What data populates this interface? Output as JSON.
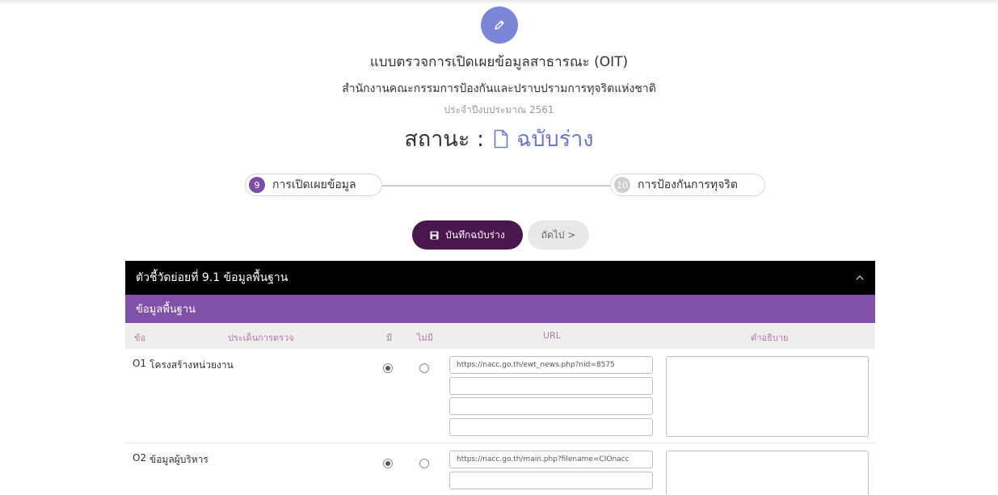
{
  "form": {
    "title": "แบบตรวจการเปิดเผยข้อมูลสาธารณะ (OIT)",
    "agency": "สำนักงานคณะกรรมการป้องกันและปราบปรามการทุจริตแห่งชาติ",
    "fiscal_year": "ประจำปีงบประมาณ 2561",
    "status_label": "สถานะ :",
    "status_value": "ฉบับร่าง"
  },
  "stepper": {
    "steps": [
      {
        "number": "9",
        "label": "การเปิดเผยข้อมูล",
        "active": true
      },
      {
        "number": "10",
        "label": "การป้องกันการทุจริต",
        "active": false
      }
    ]
  },
  "actions": {
    "save_draft": "บันทึกฉบับร่าง",
    "next": "ถัดไป >"
  },
  "panel": {
    "indicator_title": "ตัวชี้วัดย่อยที่ 9.1 ข้อมูลพื้นฐาน",
    "section_title": "ข้อมูลพื้นฐาน",
    "columns": {
      "no": "ข้อ",
      "topic": "ประเด็นการตรวจ",
      "yes": "มี",
      "no_have": "ไม่มี",
      "url": "URL",
      "description": "คำอธิบาย"
    },
    "rows": [
      {
        "code": "O1",
        "topic": "โครงสร้างหน่วยงาน",
        "has": "yes",
        "urls": [
          "https://nacc.go.th/ewt_news.php?nid=8575",
          "",
          "",
          ""
        ]
      },
      {
        "code": "O2",
        "topic": "ข้อมูลผู้บริหาร",
        "has": "yes",
        "urls": [
          "https://nacc.go.th/main.php?filename=CIOnacc",
          ""
        ]
      }
    ]
  },
  "colors": {
    "accent_circle": "#7b86d8",
    "status_text": "#6d78cf",
    "step_active": "#7b4ea6",
    "save_button": "#4b1550",
    "section_bar": "#7f51a7",
    "header_bar": "#000000"
  },
  "icons": {
    "edit": "pencil-icon",
    "status": "document-icon",
    "save": "floppy-disk-icon",
    "collapse": "chevron-up-icon"
  }
}
